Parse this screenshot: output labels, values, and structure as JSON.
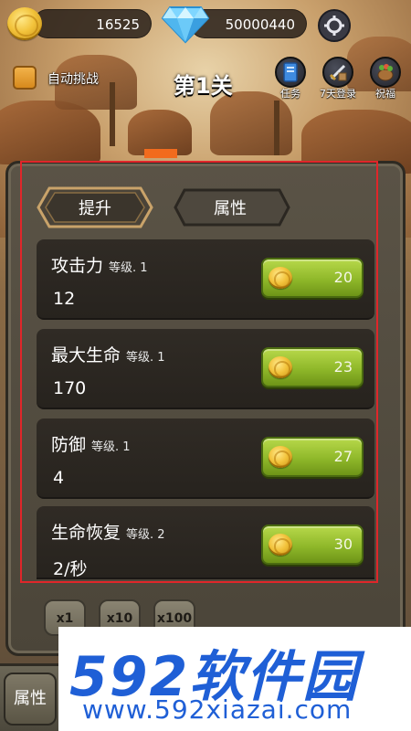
{
  "topbar": {
    "gold": "16525",
    "diamonds": "50000440"
  },
  "header": {
    "auto_battle_label": "自动挑战",
    "stage_title": "第1关",
    "quick_buttons": [
      {
        "label": "任务",
        "icon": "book-icon"
      },
      {
        "label": "7天登录",
        "icon": "sword-icon"
      },
      {
        "label": "祝福",
        "icon": "blessing-pot-icon"
      }
    ]
  },
  "tabs": [
    {
      "label": "提升",
      "active": true
    },
    {
      "label": "属性",
      "active": false
    }
  ],
  "stats": [
    {
      "name": "攻击力",
      "level": "等级. 1",
      "value": "12",
      "cost": "20"
    },
    {
      "name": "最大生命",
      "level": "等级. 1",
      "value": "170",
      "cost": "23"
    },
    {
      "name": "防御",
      "level": "等级. 1",
      "value": "4",
      "cost": "27"
    },
    {
      "name": "生命恢复",
      "level": "等级. 2",
      "value": "2/秒",
      "cost": "30"
    }
  ],
  "multipliers": [
    "x1",
    "x10",
    "x100"
  ],
  "bottom": {
    "tab_label": "属性"
  },
  "watermark": {
    "big": "592软件园",
    "small": "www.592xiazai.com"
  },
  "colors": {
    "highlight": "#e0262a",
    "upgrade_green": "#8fb82a",
    "watermark_blue": "#1f5fd6"
  }
}
